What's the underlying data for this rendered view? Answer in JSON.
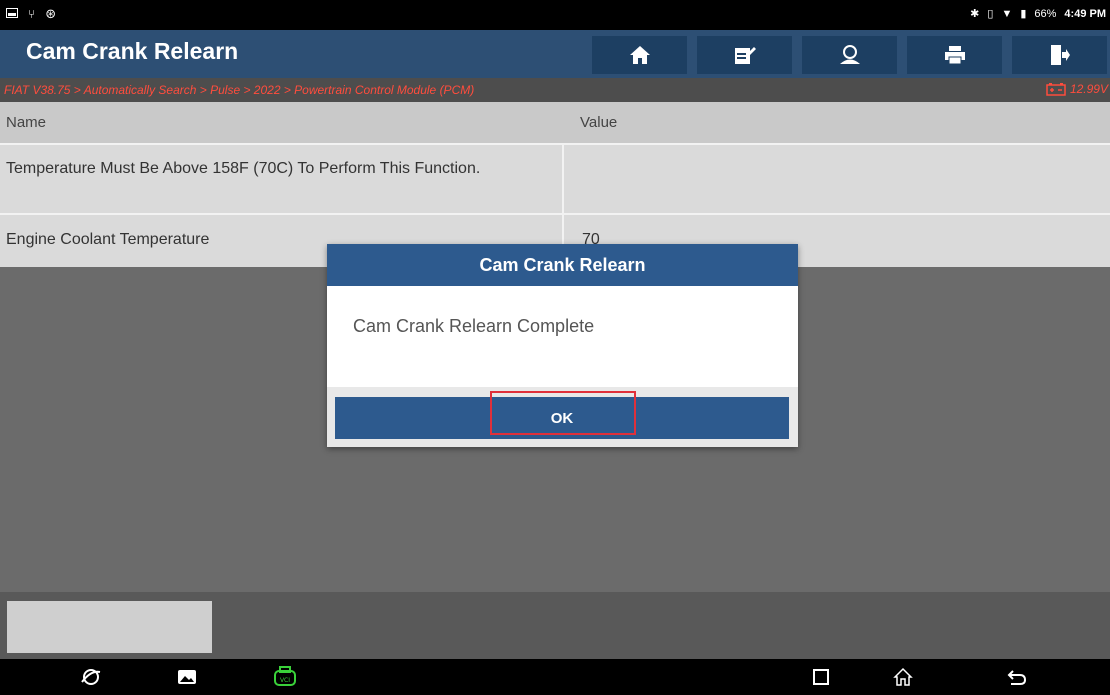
{
  "status_bar": {
    "battery_percent": "66%",
    "time": "4:49 PM"
  },
  "header": {
    "title": "Cam Crank Relearn",
    "buttons": [
      "home-icon",
      "edit-report-icon",
      "user-icon",
      "print-icon",
      "exit-icon"
    ]
  },
  "breadcrumb": {
    "path": "FIAT V38.75 > Automatically Search > Pulse > 2022 > Powertrain Control Module (PCM)",
    "voltage": "12.99V"
  },
  "table": {
    "columns": [
      "Name",
      "Value"
    ],
    "rows": [
      {
        "name": "Temperature Must Be Above 158F (70C) To Perform This Function.",
        "value": ""
      },
      {
        "name": "Engine Coolant Temperature",
        "value": "70"
      }
    ]
  },
  "dialog": {
    "title": "Cam Crank Relearn",
    "message": "Cam Crank Relearn Complete",
    "ok_label": "OK"
  },
  "colors": {
    "header_bg": "#2d4f74",
    "dialog_accent": "#2d5a8e",
    "breadcrumb_text": "#ff4d3d",
    "highlight": "#e0303a",
    "vci_icon": "#3ad13a"
  }
}
